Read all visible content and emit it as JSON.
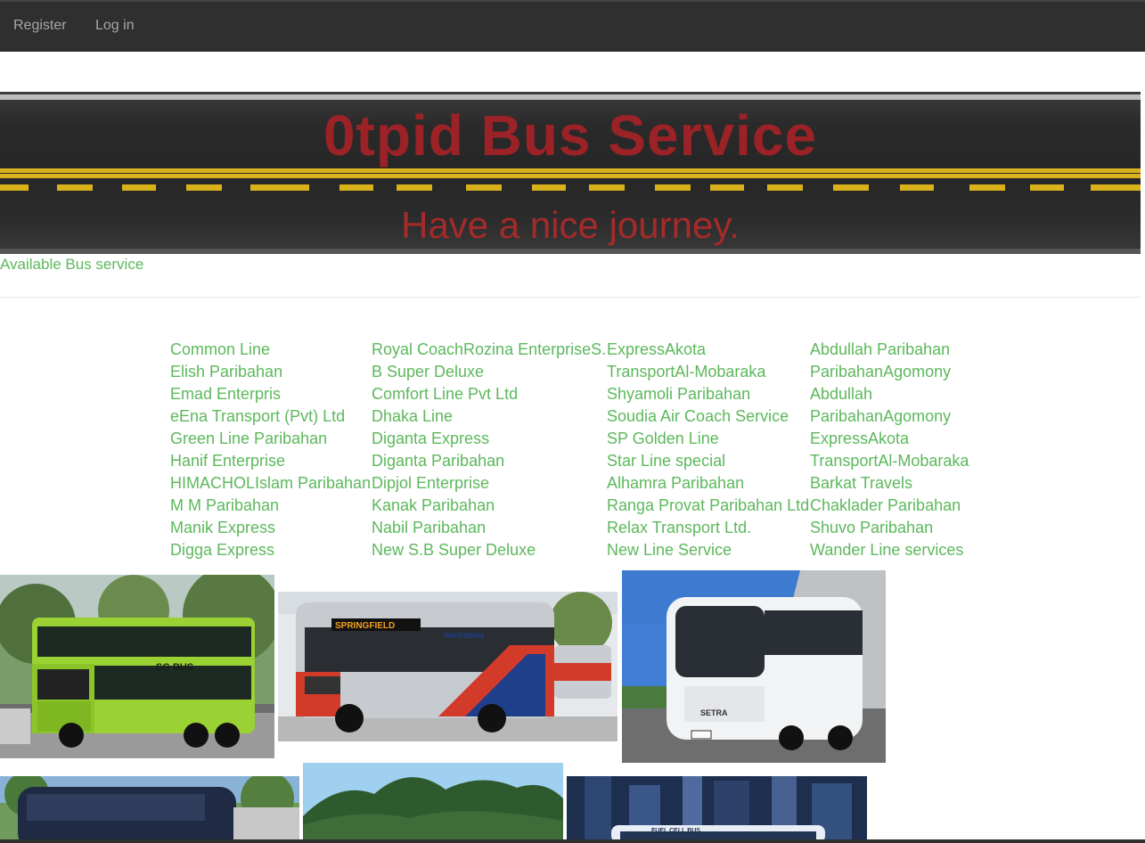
{
  "nav": {
    "register": "Register",
    "login": "Log in"
  },
  "banner": {
    "title": "0tpid Bus Service",
    "subtitle": "Have a nice journey."
  },
  "section_label": "Available Bus service",
  "bus_columns": [
    [
      "Common Line",
      "Elish Paribahan",
      "Emad Enterpris",
      "eEna Transport (Pvt) Ltd",
      "Green Line Paribahan",
      "Hanif Enterprise",
      "HIMACHOLIslam Paribahan",
      "M M Paribahan",
      "Manik Express",
      "Digga Express"
    ],
    [
      "Royal CoachRozina EnterpriseS.",
      "B Super Deluxe",
      "Comfort Line Pvt Ltd",
      "Dhaka Line",
      "Diganta Express",
      "Diganta Paribahan",
      "Dipjol Enterprise",
      "Kanak Paribahan",
      "Nabil Paribahan",
      "New S.B Super Deluxe"
    ],
    [
      "ExpressAkota",
      "TransportAl-Mobaraka",
      "Shyamoli Paribahan",
      "Soudia Air Coach Service",
      "SP Golden Line",
      "Star Line special",
      "Alhamra Paribahan",
      "Ranga Provat Paribahan Ltd",
      "Relax Transport Ltd.",
      "New Line Service"
    ],
    [
      "Abdullah Paribahan",
      "ParibahanAgomony",
      "Abdullah",
      "ParibahanAgomony",
      "ExpressAkota",
      "TransportAl-Mobaraka",
      "Barkat Travels",
      "Chaklader Paribahan",
      "Shuvo Paribahan",
      "Wander Line services"
    ]
  ],
  "photos": {
    "p1_text": "SG BUS",
    "p2_text": "SPRINGFIELD",
    "p2_brand": "metrobus",
    "p3_text": "SETRA",
    "p6_text": "FUEL CELL BUS"
  },
  "colors": {
    "nav_bg": "#2f2f2f",
    "link_green": "#5cb85c",
    "banner_red": "#9b2226"
  }
}
